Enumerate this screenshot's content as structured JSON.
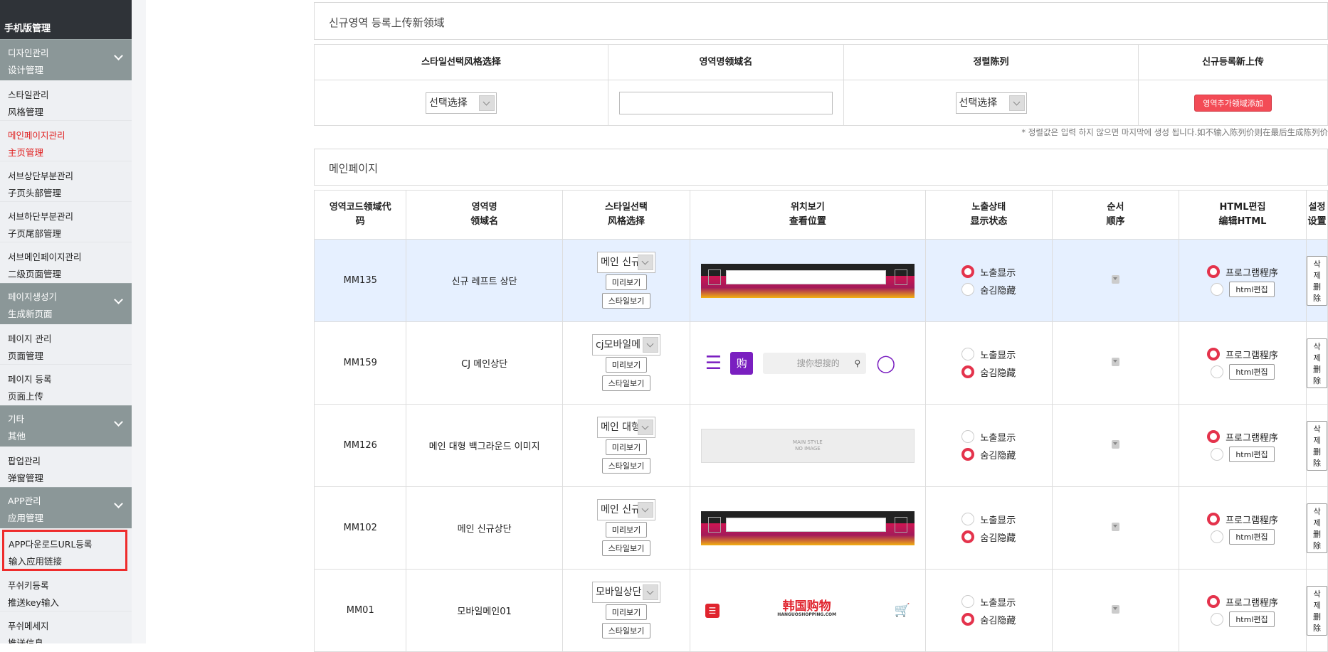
{
  "sidebar": {
    "top_title": "手机版管理",
    "groups": [
      {
        "label_ko": "디자인관리",
        "label_zh": "设计管理",
        "items": [
          {
            "ko": "스타일관리",
            "zh": "风格管理"
          },
          {
            "ko": "메인페이지관리",
            "zh": "主页管理"
          },
          {
            "ko": "서브상단부분관리",
            "zh": "子页头部管理"
          },
          {
            "ko": "서브하단부분관리",
            "zh": "子页尾部管理"
          },
          {
            "ko": "서브메인페이지관리",
            "zh": "二级页面管理"
          }
        ]
      },
      {
        "label_ko": "페이지생성기",
        "label_zh": "生成新页面",
        "items": [
          {
            "ko": "페이지 관리",
            "zh": "页面管理"
          },
          {
            "ko": "페이지 등록",
            "zh": "页面上传"
          }
        ]
      },
      {
        "label_ko": "기타",
        "label_zh": "其他",
        "items": [
          {
            "ko": "팝업관리",
            "zh": "弹窗管理"
          }
        ]
      },
      {
        "label_ko": "APP관리",
        "label_zh": "应用管理",
        "items": [
          {
            "ko": "APP다운로드URL등록",
            "zh": "输入应用链接"
          },
          {
            "ko": "푸쉬키등록",
            "zh": "推送key输入"
          },
          {
            "ko": "푸쉬메세지",
            "zh": "推送信息"
          }
        ]
      }
    ]
  },
  "upload_section": {
    "title": "신규영역 등록上传新领域",
    "headers": [
      "스타일선택风格选择",
      "영역명领域名",
      "정렬陈列",
      "신규등록新上传"
    ],
    "style_select": "선택选择",
    "order_select": "선택选择",
    "add_button": "영역추가领域添加",
    "note": "* 정렬값은 입력 하지 않으면 마지막에 생성 됩니다.如不输入陈列价则在最后生成陈列价"
  },
  "main_section": {
    "title": "메인페이지",
    "headers": [
      [
        "영역코드领域代",
        "码"
      ],
      [
        "영역명",
        "领域名"
      ],
      [
        "스타일선택",
        "风格选择"
      ],
      [
        "위치보기",
        "查看位置"
      ],
      [
        "노출상태",
        "显示状态"
      ],
      [
        "순서",
        "顺序"
      ],
      [
        "HTML편집",
        "编辑HTML"
      ],
      [
        "설정",
        "设置"
      ]
    ],
    "labels": {
      "preview": "미리보기",
      "style_view": "스타일보기",
      "show": "노출显示",
      "hide": "숨김隐藏",
      "program": "프로그램程序",
      "html_edit": "html편집",
      "delete": "삭제删除"
    },
    "rows": [
      {
        "code": "MM135",
        "name": "신규 레프트 상단",
        "style": "메인 신규",
        "visible": "show"
      },
      {
        "code": "MM159",
        "name": "CJ 메인상단",
        "style": "cj모바일메",
        "visible": "hide"
      },
      {
        "code": "MM126",
        "name": "메인 대형 백그라운드 이미지",
        "style": "메인 대형",
        "visible": "hide"
      },
      {
        "code": "MM102",
        "name": "메인 신규상단",
        "style": "메인 신규",
        "visible": "hide"
      },
      {
        "code": "MM01",
        "name": "모바일메인01",
        "style": "모바일상단",
        "visible": "hide"
      }
    ],
    "preview_texts": {
      "cj_search": "搜你想搜的",
      "cj_logo": "购",
      "noimg1": "MAIN STYLE",
      "noimg2": "NO IMAGE",
      "hanguo_logo": "韩国购物",
      "hanguo_sub": "HANGUOSHOPPING.COM"
    }
  },
  "colors": {
    "accent": "#e4334c",
    "sidebar_cat": "#8b9798",
    "sidebar_top": "#2f3338",
    "row_highlight": "#e6f0ff"
  }
}
